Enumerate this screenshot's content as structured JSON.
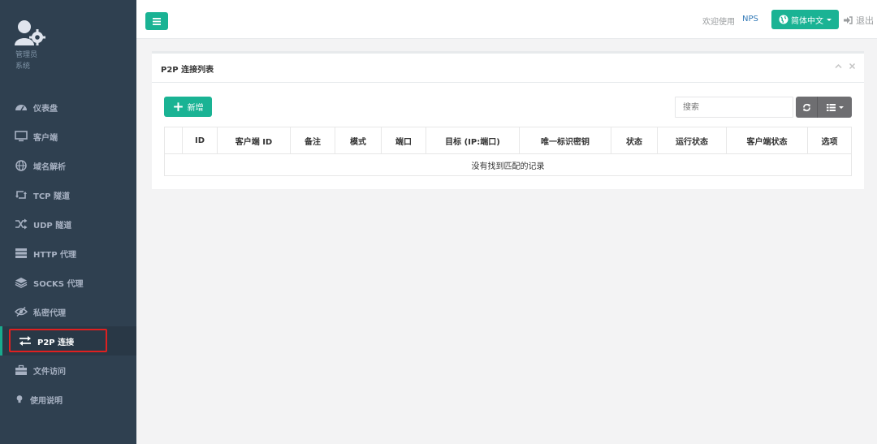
{
  "sidebar": {
    "profile": {
      "name": "管理员",
      "role": "系统"
    },
    "items": [
      {
        "label": "仪表盘",
        "icon": "dashboard-icon"
      },
      {
        "label": "客户端",
        "icon": "desktop-icon"
      },
      {
        "label": "域名解析",
        "icon": "globe-icon"
      },
      {
        "label": "TCP 隧道",
        "icon": "retweet-icon"
      },
      {
        "label": "UDP 隧道",
        "icon": "random-icon"
      },
      {
        "label": "HTTP 代理",
        "icon": "server-icon"
      },
      {
        "label": "SOCKS 代理",
        "icon": "layers-icon"
      },
      {
        "label": "私密代理",
        "icon": "eye-slash-icon"
      },
      {
        "label": "P2P 连接",
        "icon": "exchange-icon",
        "active": true
      },
      {
        "label": "文件访问",
        "icon": "briefcase-icon"
      },
      {
        "label": "使用说明",
        "icon": "lightbulb-icon"
      }
    ]
  },
  "topbar": {
    "welcome": "欢迎使用",
    "brand": "NPS",
    "language": "简体中文",
    "logout": "退出"
  },
  "panel": {
    "title": "P2P 连接列表",
    "add_label": "新增",
    "search_placeholder": "搜索",
    "columns": [
      "ID",
      "客户端 ID",
      "备注",
      "模式",
      "端口",
      "目标 (IP:端口)",
      "唯一标识密钥",
      "状态",
      "运行状态",
      "客户端状态",
      "选项"
    ],
    "empty_message": "没有找到匹配的记录"
  },
  "colors": {
    "sidebar": "#2f4050",
    "accent": "#1ab394",
    "highlight_border": "#e02020"
  }
}
